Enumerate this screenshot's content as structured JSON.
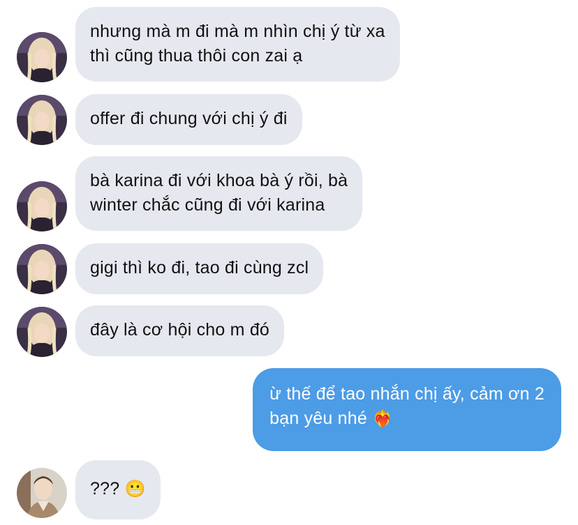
{
  "conversation": {
    "messages": [
      {
        "sender": "contact",
        "lines": [
          "nhưng mà m đi mà m nhìn chị ý từ xa",
          "thì cũng thua thôi con zai ạ"
        ]
      },
      {
        "sender": "contact",
        "lines": [
          "offer đi chung với chị ý đi"
        ]
      },
      {
        "sender": "contact",
        "lines": [
          "bà karina đi với khoa bà ý rồi, bà",
          "winter chắc cũng đi với karina"
        ]
      },
      {
        "sender": "contact",
        "lines": [
          "gigi thì ko đi, tao đi cùng zcl"
        ]
      },
      {
        "sender": "contact",
        "lines": [
          "đây là cơ hội cho m đó"
        ]
      },
      {
        "sender": "me",
        "lines": [
          "ừ thế để tao nhắn chị ấy, cảm ơn 2",
          "bạn yêu nhé"
        ],
        "emoji": "❤️‍🔥"
      },
      {
        "sender": "contact2",
        "lines": [
          "???"
        ],
        "emoji": "😬"
      }
    ]
  },
  "colors": {
    "incoming_bubble": "#e5e8ee",
    "outgoing_bubble": "#4c9ce6",
    "incoming_text": "#111111",
    "outgoing_text": "#ffffff"
  },
  "icons": {
    "contact_avatar": "avatar-blonde-woman",
    "contact2_avatar": "avatar-man-icon"
  }
}
